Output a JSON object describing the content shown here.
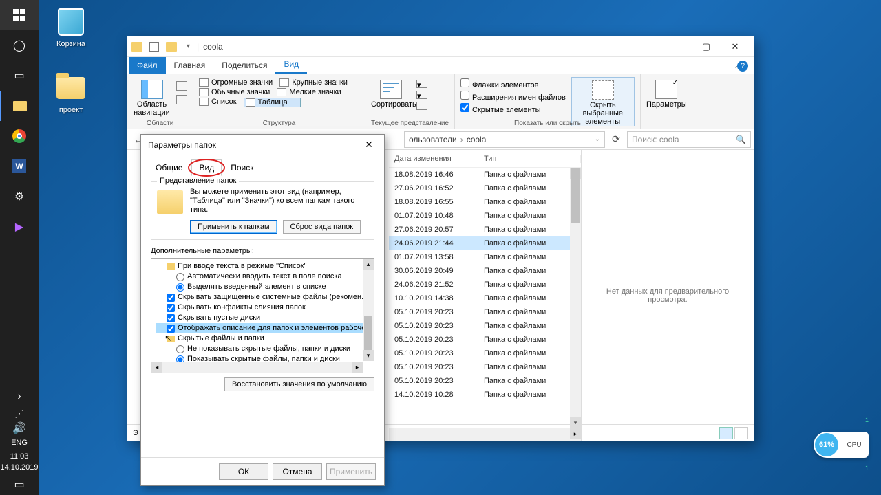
{
  "desktop": {
    "recycle_bin": "Корзина",
    "project": "проект"
  },
  "taskbar": {
    "lang": "ENG",
    "time": "11:03",
    "date": "14.10.2019"
  },
  "explorer": {
    "title": "coola",
    "tabs": {
      "file": "Файл",
      "home": "Главная",
      "share": "Поделиться",
      "view": "Вид"
    },
    "ribbon": {
      "nav_pane": "Область навигации",
      "areas": "Области",
      "icons_huge": "Огромные значки",
      "icons_large": "Крупные значки",
      "icons_normal": "Обычные значки",
      "icons_medium": "Мелкие значки",
      "icons_list": "Список",
      "icons_table": "Таблица",
      "structure": "Структура",
      "sort": "Сортировать",
      "current_view": "Текущее представление",
      "item_checkboxes": "Флажки элементов",
      "file_ext": "Расширения имен файлов",
      "hidden_items": "Скрытые элементы",
      "hide_selected": "Скрыть выбранные элементы",
      "show_hide": "Показать или скрыть",
      "options": "Параметры"
    },
    "breadcrumb": {
      "users": "ользователи",
      "folder": "coola"
    },
    "search_placeholder": "Поиск: coola",
    "columns": {
      "date": "Дата изменения",
      "type": "Тип"
    },
    "type_folder": "Папка с файлами",
    "dates": [
      "18.08.2019 16:46",
      "27.06.2019 16:52",
      "18.08.2019 16:55",
      "01.07.2019 10:48",
      "27.06.2019 20:57",
      "24.06.2019 21:44",
      "01.07.2019 13:58",
      "30.06.2019 20:49",
      "24.06.2019 21:52",
      "10.10.2019 14:38",
      "05.10.2019 20:23",
      "05.10.2019 20:23",
      "05.10.2019 20:23",
      "05.10.2019 20:23",
      "05.10.2019 20:23",
      "05.10.2019 20:23",
      "14.10.2019 10:28"
    ],
    "selected_index": 5,
    "no_preview": "Нет данных для предварительного просмотра."
  },
  "folder_options": {
    "title": "Параметры папок",
    "tab_general": "Общие",
    "tab_view": "Вид",
    "tab_search": "Поиск",
    "folder_view_legend": "Представление папок",
    "folder_view_desc": "Вы можете применить этот вид (например, \"Таблица\" или \"Значки\") ко всем папкам такого типа.",
    "apply_to_folders": "Применить к папкам",
    "reset_folders": "Сброс вида папок",
    "adv_label": "Дополнительные параметры:",
    "items": {
      "typing_group": "При вводе текста в режиме \"Список\"",
      "auto_search": "Автоматически вводить текст в поле поиска",
      "select_typed": "Выделять введенный элемент в списке",
      "hide_protected": "Скрывать защищенные системные файлы (рекомен.",
      "hide_merge": "Скрывать конфликты слияния папок",
      "hide_empty": "Скрывать пустые диски",
      "show_desc": "Отображать описание для папок и элементов рабочего стола",
      "hidden_group": "Скрытые файлы и папки",
      "dont_show": "Не показывать скрытые файлы, папки и диски",
      "do_show": "Показывать скрытые файлы, папки и диски"
    },
    "restore_defaults": "Восстановить значения по умолчанию",
    "ok": "ОК",
    "cancel": "Отмена",
    "apply": "Применить"
  },
  "cpu": {
    "percent": "61%",
    "label": "CPU"
  }
}
